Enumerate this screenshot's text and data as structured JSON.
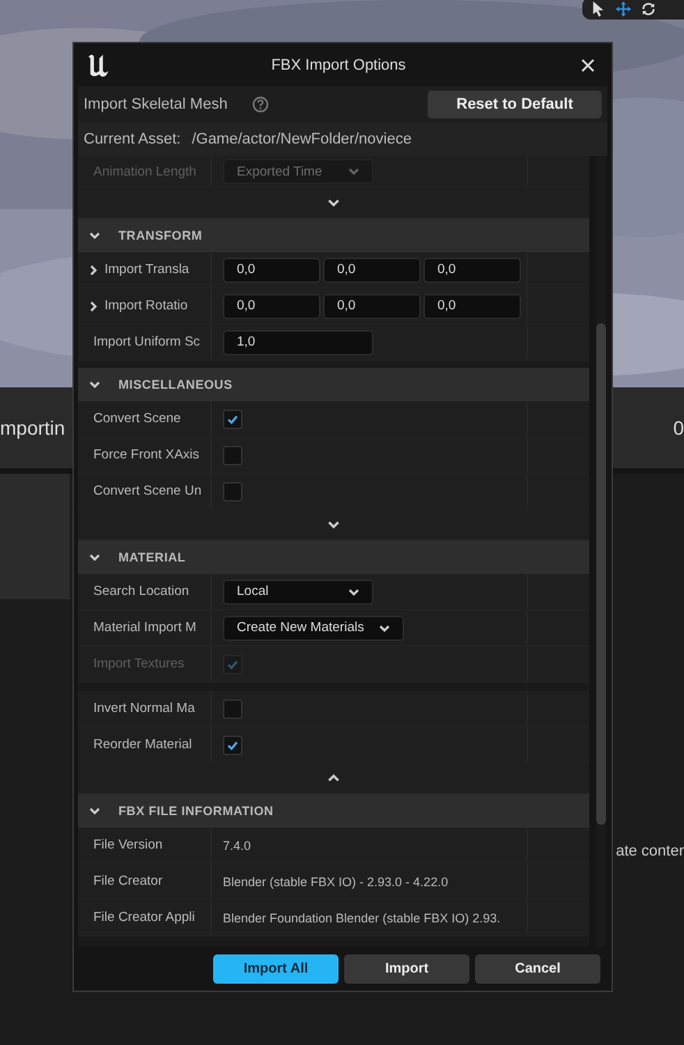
{
  "background": {
    "panel_label": "mportin",
    "panel_value": "0",
    "side_text": "ate conter"
  },
  "dialog": {
    "title": "FBX Import Options",
    "import_type": "Import Skeletal Mesh",
    "reset_button": "Reset to Default",
    "current_asset_label": "Current Asset:",
    "current_asset_path": "/Game/actor/NewFolder/noviece",
    "sections": [
      {
        "properties": [
          {
            "kind": "dropdown",
            "label": "Animation Length",
            "value": "Exported Time",
            "disabled": true
          }
        ],
        "advanced_expanded": false
      },
      {
        "title": "TRANSFORM",
        "expanded": true,
        "properties": [
          {
            "kind": "vector",
            "label": "Import Transla",
            "values": [
              "0,0",
              "0,0",
              "0,0"
            ],
            "expanded": false
          },
          {
            "kind": "vector",
            "label": "Import Rotatio",
            "values": [
              "0,0",
              "0,0",
              "0,0"
            ],
            "expanded": false
          },
          {
            "kind": "number",
            "label": "Import Uniform Sc",
            "value": "1,0"
          }
        ]
      },
      {
        "title": "MISCELLANEOUS",
        "expanded": true,
        "properties": [
          {
            "kind": "checkbox",
            "label": "Convert Scene",
            "checked": true,
            "disabled": false
          },
          {
            "kind": "checkbox",
            "label": "Force Front XAxis",
            "checked": false,
            "disabled": false
          },
          {
            "kind": "checkbox",
            "label": "Convert Scene Un",
            "checked": false,
            "disabled": false
          }
        ],
        "advanced_expanded": false
      },
      {
        "title": "MATERIAL",
        "expanded": true,
        "properties": [
          {
            "kind": "dropdown",
            "label": "Search Location",
            "value": "Local",
            "disabled": false
          },
          {
            "kind": "dropdown",
            "label": "Material Import M",
            "value": "Create New Materials",
            "disabled": false
          },
          {
            "kind": "checkbox",
            "label": "Import Textures",
            "checked": true,
            "disabled": true
          }
        ],
        "advanced_properties": [
          {
            "kind": "checkbox",
            "label": "Invert Normal Ma",
            "checked": false,
            "disabled": false
          },
          {
            "kind": "checkbox",
            "label": "Reorder Material",
            "checked": true,
            "disabled": false
          }
        ],
        "advanced_expanded": true
      },
      {
        "title": "FBX FILE INFORMATION",
        "expanded": true,
        "properties": [
          {
            "kind": "text",
            "label": "File Version",
            "value": "7.4.0"
          },
          {
            "kind": "text",
            "label": "File Creator",
            "value": "Blender (stable FBX IO) - 2.93.0 - 4.22.0"
          },
          {
            "kind": "text",
            "label": "File Creator Appli",
            "value": "Blender Foundation Blender (stable FBX IO) 2.93."
          }
        ]
      }
    ],
    "buttons": [
      {
        "label": "Import All",
        "primary": true
      },
      {
        "label": "Import",
        "primary": false
      },
      {
        "label": "Cancel",
        "primary": false
      }
    ]
  }
}
